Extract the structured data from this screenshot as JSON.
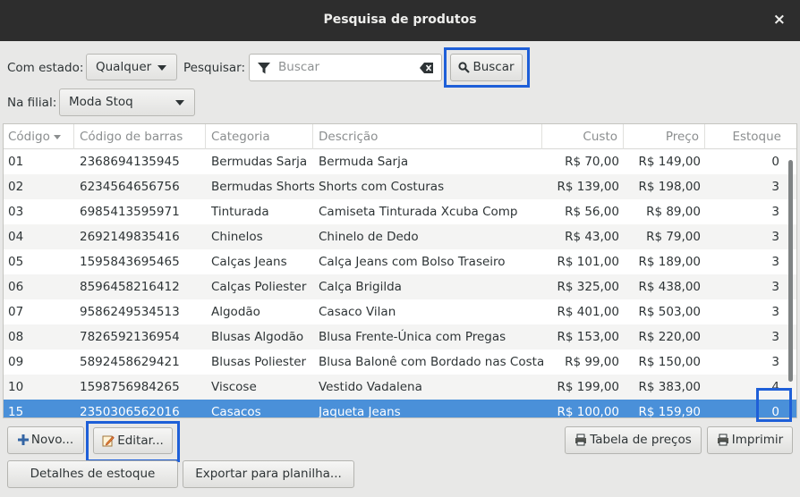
{
  "window": {
    "title": "Pesquisa de produtos",
    "close": "×"
  },
  "filters": {
    "status_label": "Com estado:",
    "status_value": "Qualquer",
    "search_label": "Pesquisar:",
    "search_placeholder": "Buscar",
    "search_button": "Buscar",
    "branch_label": "Na filial:",
    "branch_value": "Moda Stoq"
  },
  "table": {
    "columns": [
      "Código",
      "Código de barras",
      "Categoria",
      "Descrição",
      "Custo",
      "Preço",
      "Estoque"
    ],
    "rows": [
      [
        "01",
        "2368694135945",
        "Bermudas Sarja",
        "Bermuda Sarja",
        "R$ 70,00",
        "R$ 149,00",
        "0"
      ],
      [
        "02",
        "6234564656756",
        "Bermudas Shorts",
        "Shorts com Costuras",
        "R$ 139,00",
        "R$ 198,00",
        "3"
      ],
      [
        "03",
        "6985413595971",
        "Tinturada",
        "Camiseta Tinturada Xcuba Comp",
        "R$ 56,00",
        "R$ 89,00",
        "3"
      ],
      [
        "04",
        "2692149835416",
        "Chinelos",
        "Chinelo de Dedo",
        "R$ 43,00",
        "R$ 79,00",
        "3"
      ],
      [
        "05",
        "1595843695465",
        "Calças Jeans",
        "Calça Jeans com Bolso Traseiro",
        "R$ 101,00",
        "R$ 189,00",
        "3"
      ],
      [
        "06",
        "8596458216412",
        "Calças Poliester",
        "Calça Brigilda",
        "R$ 325,00",
        "R$ 438,00",
        "3"
      ],
      [
        "07",
        "9586249534513",
        "Algodão",
        "Casaco Vilan",
        "R$ 401,00",
        "R$ 503,00",
        "3"
      ],
      [
        "08",
        "7826592136954",
        "Blusas Algodão",
        "Blusa Frente-Única com Pregas",
        "R$ 153,00",
        "R$ 220,00",
        "3"
      ],
      [
        "09",
        "5892458629421",
        "Blusas Poliester",
        "Blusa Balonê com Bordado nas Costas",
        "R$ 99,00",
        "R$ 150,00",
        "3"
      ],
      [
        "10",
        "1598756984265",
        "Viscose",
        "Vestido Vadalena",
        "R$ 199,00",
        "R$ 383,00",
        "4"
      ],
      [
        "15",
        "2350306562016",
        "Casacos",
        "Jaqueta Jeans",
        "R$ 100,00",
        "R$ 159,90",
        "0"
      ]
    ],
    "selected_index": 10
  },
  "actions": {
    "new": "Novo...",
    "edit": "Editar...",
    "price_table": "Tabela de preços",
    "print": "Imprimir",
    "stock_details": "Detalhes de estoque",
    "export": "Exportar para planilha..."
  },
  "colors": {
    "titlebar": "#2d2d2d",
    "selection": "#4a90d9",
    "highlight": "#1e5fd8"
  }
}
